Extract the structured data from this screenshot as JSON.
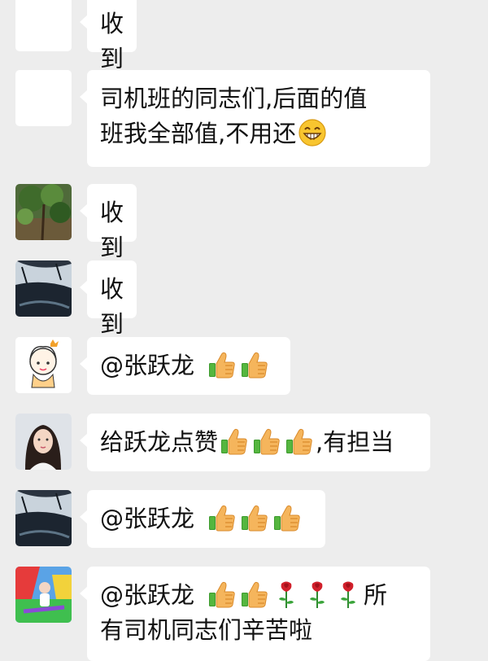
{
  "messages": [
    {
      "avatar": "blank-avatar",
      "text": "收到"
    },
    {
      "avatar": "blank-avatar",
      "text_line1": "司机班的同志们,后面的值",
      "text_line2": "班我全部值,不用还"
    },
    {
      "avatar": "tree-avatar",
      "text": "收到"
    },
    {
      "avatar": "dark-landscape-avatar",
      "text": "收到"
    },
    {
      "avatar": "cartoon-girl-avatar",
      "mention": "@张跃龙"
    },
    {
      "avatar": "woman-portrait-avatar",
      "text_before": "给跃龙点赞",
      "text_after": ",有担当"
    },
    {
      "avatar": "dark-landscape-avatar",
      "mention": "@张跃龙"
    },
    {
      "avatar": "child-playground-avatar",
      "mention": "@张跃龙",
      "text_tail": "所",
      "text_line2": "有司机同志们辛苦啦"
    }
  ],
  "emoji": {
    "grin": "grinning-face-emoji",
    "thumbs": "thumbs-up-emoji",
    "rose": "rose-emoji"
  },
  "colors": {
    "background": "#ededed",
    "bubble": "#ffffff",
    "text": "#111111"
  }
}
